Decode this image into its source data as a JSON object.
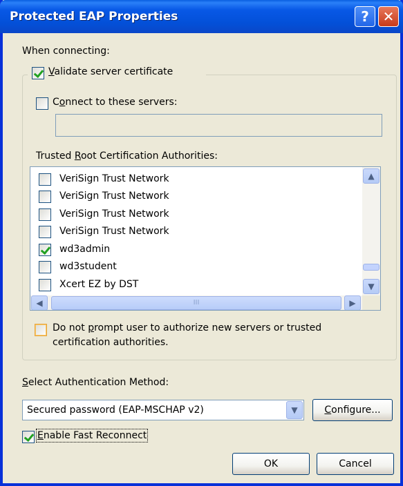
{
  "window": {
    "title": "Protected EAP Properties",
    "help_glyph": "?",
    "close_glyph": "✕"
  },
  "when_connecting": "When connecting:",
  "validate": {
    "pre": "",
    "accel": "V",
    "post": "alidate server certificate",
    "checked": true
  },
  "connect_servers": {
    "pre": "C",
    "accel": "o",
    "post": "nnect to these servers:",
    "checked": false,
    "value": ""
  },
  "trusted_label": {
    "pre": "Trusted ",
    "accel": "R",
    "post": "oot Certification Authorities:"
  },
  "trusted_list": [
    {
      "label": "VeriSign Trust Network",
      "checked": false
    },
    {
      "label": "VeriSign Trust Network",
      "checked": false
    },
    {
      "label": "VeriSign Trust Network",
      "checked": false
    },
    {
      "label": "VeriSign Trust Network",
      "checked": false
    },
    {
      "label": "wd3admin",
      "checked": true
    },
    {
      "label": "wd3student",
      "checked": false
    },
    {
      "label": "Xcert EZ by DST",
      "checked": false
    }
  ],
  "scroll": {
    "up": "▲",
    "down": "▼",
    "left": "◀",
    "right": "▶",
    "grip": "III"
  },
  "no_prompt": {
    "line1_pre": "Do not ",
    "line1_accel": "p",
    "line1_post": "rompt user to authorize new servers or trusted",
    "line2": "certification authorities.",
    "checked": false
  },
  "auth_method_label": {
    "pre": "",
    "accel": "S",
    "post": "elect Authentication Method:"
  },
  "auth_method": {
    "value": "Secured password (EAP-MSCHAP v2)",
    "arrow": "▼"
  },
  "configure_button": {
    "pre": "",
    "accel": "C",
    "post": "onfigure..."
  },
  "fast_reconnect": {
    "pre": "",
    "accel": "E",
    "post": "nable Fast Reconnect",
    "checked": true
  },
  "ok_label": "OK",
  "cancel_label": "Cancel"
}
